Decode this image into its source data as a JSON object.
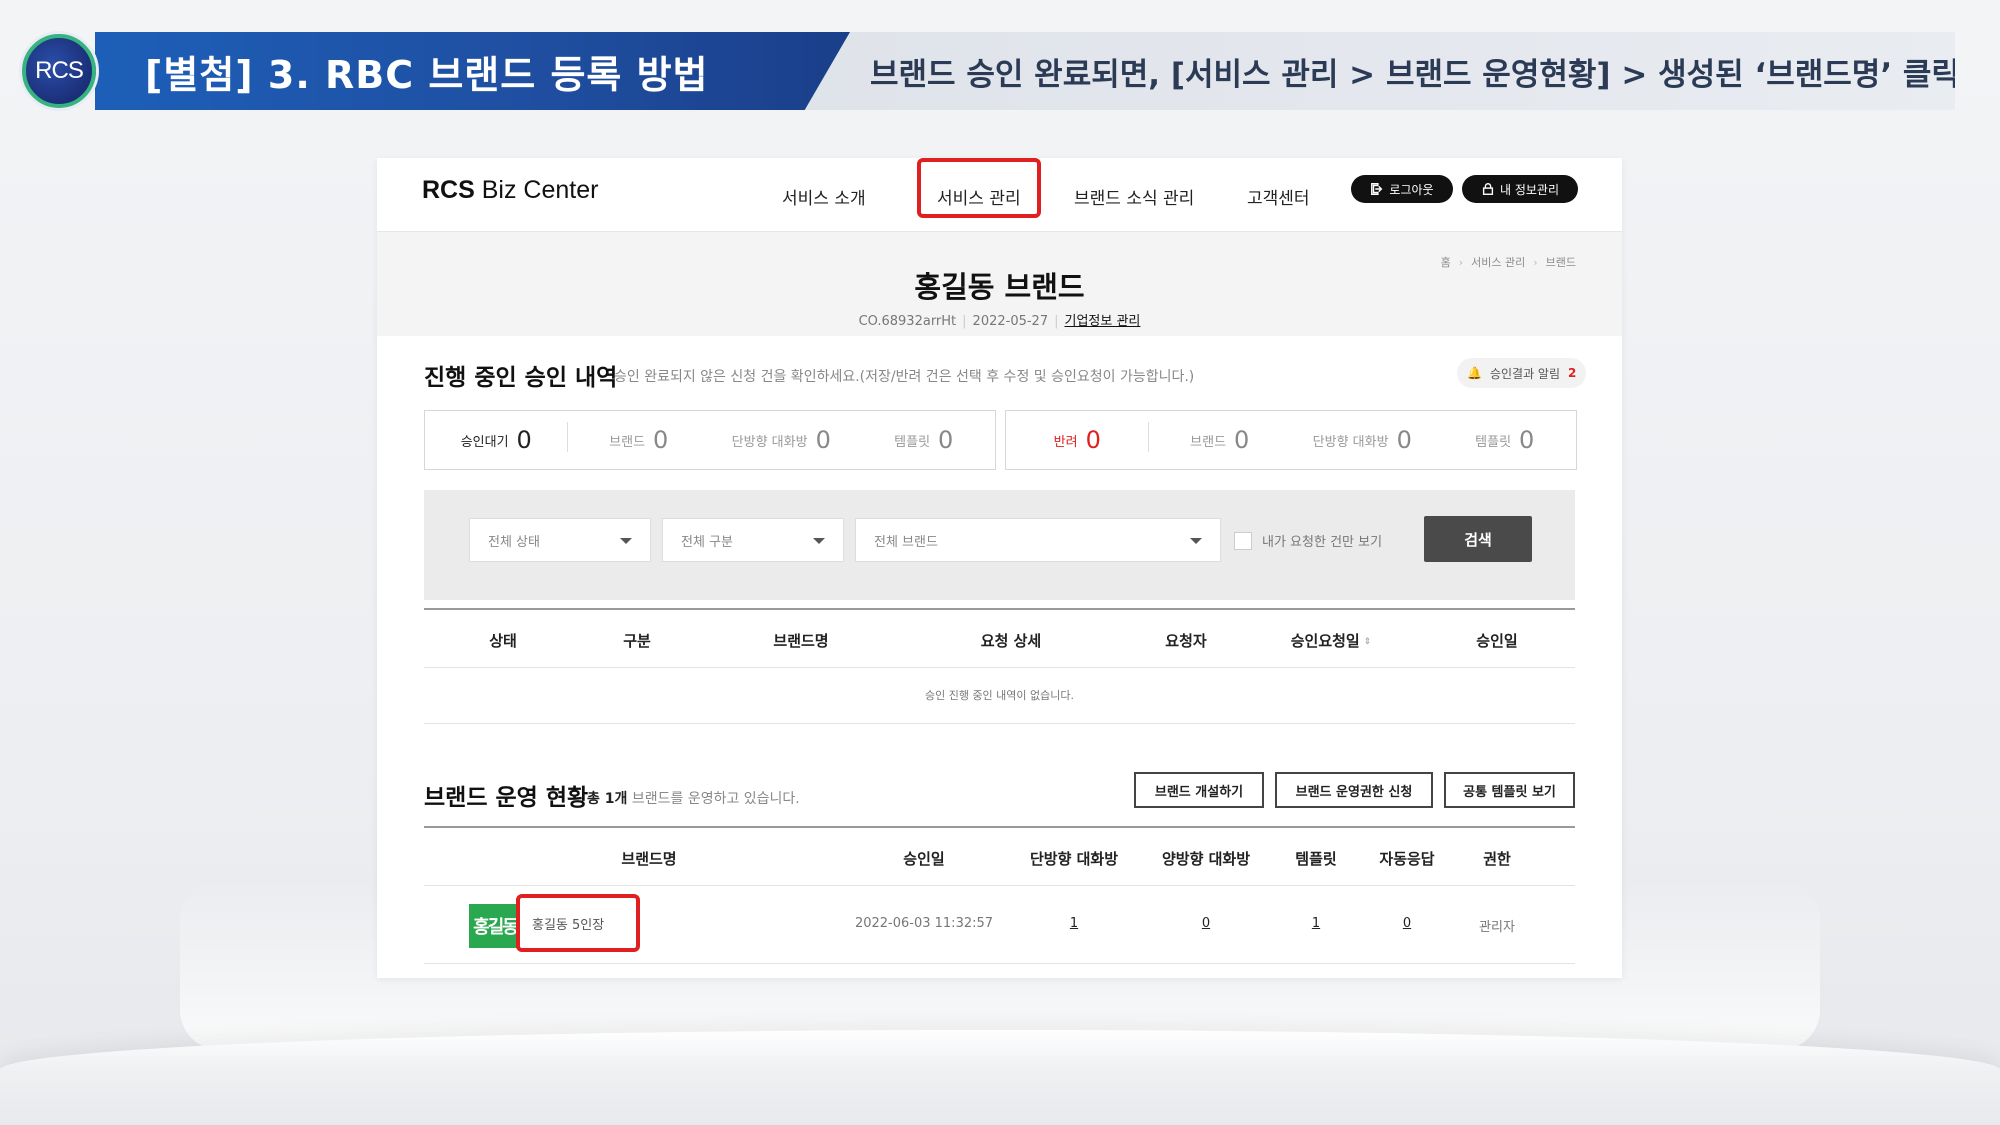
{
  "slide": {
    "logo_text": "RCS",
    "title": "[별첨] 3. RBC 브랜드 등록 방법",
    "subtitle": "브랜드 승인 완료되면, [서비스 관리 > 브랜드 운영현황] > 생성된 ‘브랜드명’ 클릭",
    "colors": {
      "title_band": "#1d5fb8",
      "highlight": "#e02020",
      "brand_thumb": "#2aa84f"
    }
  },
  "nav": {
    "logo_bold": "RCS",
    "logo_rest": " Biz Center",
    "items": [
      "서비스 소개",
      "서비스 관리",
      "브랜드 소식 관리",
      "고객센터"
    ],
    "logout": "로그아웃",
    "my_info": "내 정보관리",
    "icons": [
      "logout-icon",
      "lock-icon"
    ]
  },
  "page_head": {
    "breadcrumb": [
      "홈",
      "서비스 관리",
      "브랜드"
    ],
    "title": "홍길동 브랜드",
    "brand_id": "CO.68932arrHt",
    "date": "2022-05-27",
    "corp_link": "기업정보 관리"
  },
  "approvals": {
    "title": "진행 중인 승인 내역",
    "desc": "승인 완료되지 않은 신청 건을 확인하세요.(저장/반려 건은 선택 후 수정 및 승인요청이 가능합니다.)",
    "alarm_label": "승인결과 알림",
    "alarm_count": "2",
    "pending": [
      {
        "label": "승인대기",
        "value": "0"
      },
      {
        "label": "브랜드",
        "value": "0"
      },
      {
        "label": "단방향 대화방",
        "value": "0"
      },
      {
        "label": "템플릿",
        "value": "0"
      }
    ],
    "rejected": [
      {
        "label": "반려",
        "value": "0"
      },
      {
        "label": "브랜드",
        "value": "0"
      },
      {
        "label": "단방향 대화방",
        "value": "0"
      },
      {
        "label": "템플릿",
        "value": "0"
      }
    ]
  },
  "filters": {
    "status": "전체 상태",
    "type": "전체 구분",
    "brand": "전체 브랜드",
    "mine_only": "내가 요청한 건만 보기",
    "search": "검색"
  },
  "approval_table": {
    "columns": [
      "상태",
      "구분",
      "브랜드명",
      "요청 상세",
      "요청자",
      "승인요청일",
      "승인일"
    ],
    "empty": "승인 진행 중인 내역이 없습니다."
  },
  "brand_status": {
    "title": "브랜드 운영 현황",
    "count_prefix": "총 1개",
    "count_suffix": "브랜드를 운영하고 있습니다.",
    "buttons": [
      "브랜드 개설하기",
      "브랜드 운영권한 신청",
      "공통 템플릿 보기"
    ],
    "columns": [
      "브랜드명",
      "승인일",
      "단방향 대화방",
      "양방향 대화방",
      "템플릿",
      "자동응답",
      "권한"
    ],
    "rows": [
      {
        "thumb": "홍길동",
        "name": "홍길동 5인장",
        "approved": "2022-06-03 11:32:57",
        "oneway": "1",
        "twoway": "0",
        "templates": "1",
        "autoreply": "0",
        "role": "관리자"
      }
    ]
  }
}
